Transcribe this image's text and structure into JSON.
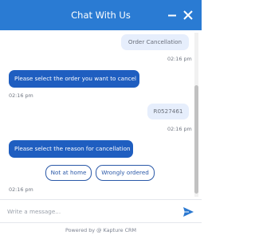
{
  "header": {
    "title": "Chat With Us",
    "minimize_icon": "minimize-icon",
    "close_icon": "close-icon",
    "bg_color": "#2a7bd3"
  },
  "messages": [
    {
      "from": "user",
      "text": "Order Cancellation",
      "time": "02:16 pm"
    },
    {
      "from": "bot",
      "text": "Please select the order you want to cancel",
      "time": "02:16 pm"
    },
    {
      "from": "user",
      "text": "R0527461",
      "time": "02:16 pm"
    },
    {
      "from": "bot",
      "text": "Please select the reason for cancellation",
      "time": "02:16 pm"
    }
  ],
  "options": [
    "Not at home",
    "Wrongly ordered"
  ],
  "composer": {
    "placeholder": "Write a message...",
    "send_icon": "send-icon"
  },
  "footer": {
    "text": "Powered by @ Kapture CRM"
  },
  "colors": {
    "bot_bubble": "#1f5ec0",
    "user_bubble": "#e6eefc",
    "option_border": "#2b59a8"
  }
}
